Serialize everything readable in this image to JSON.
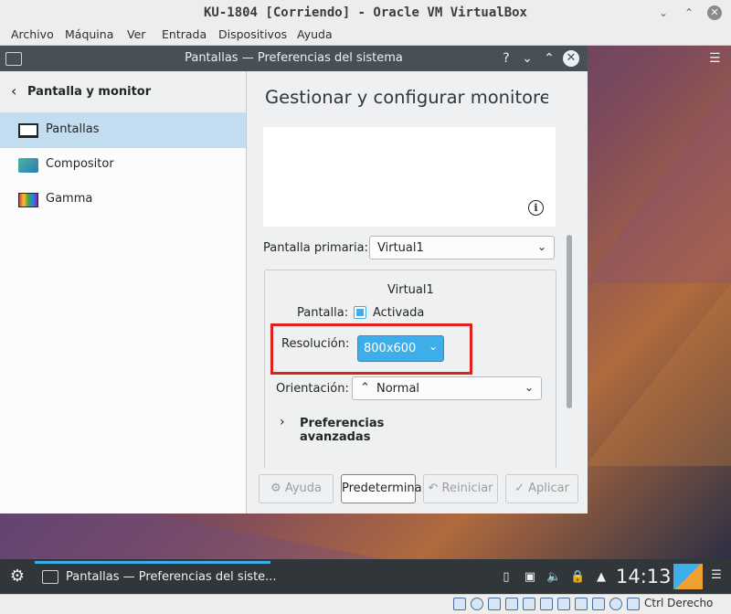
{
  "host": {
    "title": "KU-1804 [Corriendo] - Oracle VM VirtualBox",
    "menu": [
      "Archivo",
      "Máquina",
      "Ver",
      "Entrada",
      "Dispositivos",
      "Ayuda"
    ],
    "host_key": "Ctrl Derecho"
  },
  "window": {
    "title": "Pantallas — Preferencias del sistema",
    "help_glyph": "?"
  },
  "sidebar": {
    "back_label": "Pantalla y monitor",
    "items": [
      {
        "label": "Pantallas",
        "icon": "monitor-icon",
        "selected": true
      },
      {
        "label": "Compositor",
        "icon": "compositor-icon",
        "selected": false
      },
      {
        "label": "Gamma",
        "icon": "gamma-icon",
        "selected": false
      }
    ]
  },
  "main": {
    "heading": "Gestionar y configurar monitores y pantallas",
    "primary_label": "Pantalla primaria:",
    "primary_value": "Virtual1",
    "group_title": "Virtual1",
    "screen_label": "Pantalla:",
    "enabled_label": "Activada",
    "enabled": true,
    "resolution_label": "Resolución:",
    "resolution_value": "800x600",
    "orientation_label": "Orientación:",
    "orientation_value": "Normal",
    "advanced_label": "Preferencias avanzadas"
  },
  "buttons": {
    "help": "Ayuda",
    "defaults": "Predetermina",
    "reset": "Reiniciar",
    "apply": "Aplicar"
  },
  "taskbar": {
    "task_label": "Pantallas — Preferencias del siste...",
    "clock": "14:13"
  },
  "colors": {
    "accent": "#3daee9",
    "highlight_box": "#e0201c",
    "selection": "#c2dcf0",
    "titlebar": "#475057"
  }
}
